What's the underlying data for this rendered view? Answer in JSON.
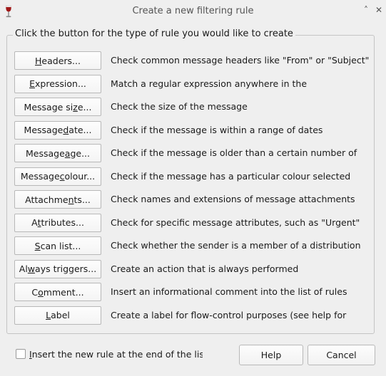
{
  "window": {
    "title": "Create a new filtering rule",
    "minimize_glyph": "˄",
    "close_glyph": "✕",
    "icon": "wine-glass-icon"
  },
  "group": {
    "legend": "Click the button for the type of rule you would like to create"
  },
  "rules": [
    {
      "id": "headers",
      "pre": "",
      "mn": "H",
      "post": "eaders...",
      "desc": "Check common message headers like \"From\" or \"Subject\""
    },
    {
      "id": "expression",
      "pre": "",
      "mn": "E",
      "post": "xpression...",
      "desc": "Match a regular expression anywhere in the"
    },
    {
      "id": "message-size",
      "pre": "Message si",
      "mn": "z",
      "post": "e...",
      "desc": "Check the size of the message"
    },
    {
      "id": "message-date",
      "pre": "Message ",
      "mn": "d",
      "post": "ate...",
      "desc": "Check if the message is within a range of dates"
    },
    {
      "id": "message-age",
      "pre": "Message ",
      "mn": "a",
      "post": "ge...",
      "desc": "Check if the message is older than a certain number of"
    },
    {
      "id": "message-colour",
      "pre": "Message ",
      "mn": "c",
      "post": "olour...",
      "desc": "Check if the message has a particular colour selected"
    },
    {
      "id": "attachments",
      "pre": "Attachme",
      "mn": "n",
      "post": "ts...",
      "desc": "Check names and extensions of message attachments"
    },
    {
      "id": "attributes",
      "pre": "A",
      "mn": "t",
      "post": "tributes...",
      "desc": "Check for specific message attributes, such as \"Urgent\""
    },
    {
      "id": "scan-list",
      "pre": "",
      "mn": "S",
      "post": "can list...",
      "desc": "Check whether the sender is a member of a distribution"
    },
    {
      "id": "always-triggers",
      "pre": "Al",
      "mn": "w",
      "post": "ays triggers...",
      "desc": "Create an action that is always performed"
    },
    {
      "id": "comment",
      "pre": "C",
      "mn": "o",
      "post": "mment...",
      "desc": "Insert an informational comment into the list of rules"
    },
    {
      "id": "label",
      "pre": "",
      "mn": "L",
      "post": "abel",
      "desc": "Create a label for flow-control purposes (see help for"
    }
  ],
  "footer": {
    "checkbox_mn": "I",
    "checkbox_rest": "nsert the new rule at the end of the list",
    "checkbox_checked": false,
    "help_label": "Help",
    "cancel_label": "Cancel"
  }
}
